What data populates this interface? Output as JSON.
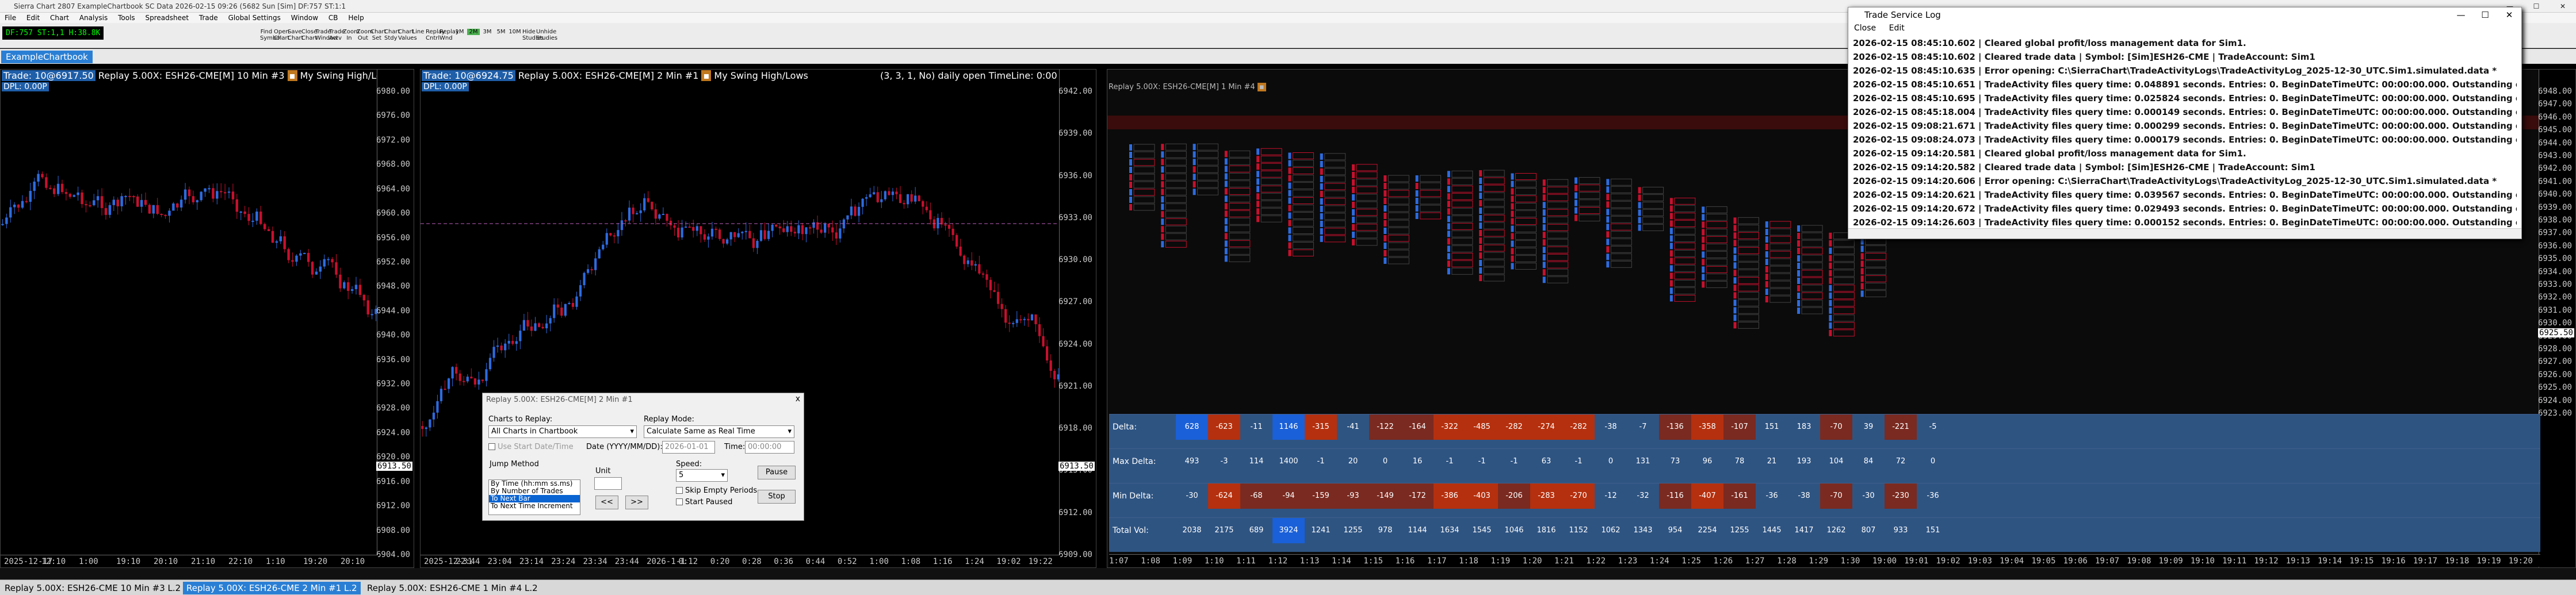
{
  "app": {
    "title": "Sierra Chart 2807 ExampleChartbook SC Data 2026-02-15 09:26 (5682 Sun [Sim] DF:757 ST:1:1",
    "window_buttons": [
      "—",
      "☐",
      "✕"
    ]
  },
  "menu": [
    "File",
    "Edit",
    "Chart",
    "Analysis",
    "Tools",
    "Spreadsheet",
    "Trade",
    "Global Settings",
    "Window",
    "CB",
    "Help"
  ],
  "toolbar": {
    "symbol_box": "DF:757  ST:1,1  H:38.8K",
    "buttons": [
      [
        "Find",
        "Symbol"
      ],
      [
        "Open",
        "Chart"
      ],
      [
        "Save",
        "Chart"
      ],
      [
        "Close",
        "Chart"
      ],
      [
        "Trade",
        "Window"
      ],
      [
        "Trade",
        "Actv"
      ],
      [
        "Zoom",
        "In"
      ],
      [
        "Zoom",
        "Out"
      ],
      [
        "Chart",
        "Set"
      ],
      [
        "Chart",
        "Stdy"
      ],
      [
        "Chart",
        "Values"
      ],
      [
        "Line"
      ],
      [
        "Replay",
        "Cntrl"
      ],
      [
        "Replay",
        "Wnd"
      ],
      [
        "1M"
      ],
      [
        "2M"
      ],
      [
        "3M"
      ],
      [
        "5M"
      ],
      [
        "10M"
      ],
      [
        "Hide",
        "Studies"
      ],
      [
        "Unhide",
        "Studies"
      ]
    ]
  },
  "chartbook_tab": "ExampleChartbook",
  "chart1": {
    "header_trade": "Trade: 10@6917.50",
    "header_rest": "Replay 5.00X: ESH26-CME[M]  10 Min  #3",
    "study": "My Swing High/Lows",
    "dpl": "DPL: 0.00P",
    "price_labels": [
      "6980.00",
      "6976.00",
      "6972.00",
      "6968.00",
      "6964.00",
      "6960.00",
      "6956.00",
      "6952.00",
      "6948.00",
      "6944.00",
      "6940.00",
      "6936.00",
      "6932.00",
      "6928.00",
      "6924.00",
      "6920.00",
      "6916.00",
      "6912.00",
      "6908.00",
      "6904.00"
    ],
    "last_price": "6913.50",
    "time_labels": [
      "2025-12-17",
      "12:10",
      "1:00",
      "19:10",
      "20:10",
      "21:10",
      "22:10",
      "1:10",
      "19:20",
      "20:10"
    ]
  },
  "chart2": {
    "header_trade": "Trade: 10@6924.75",
    "header_rest": "Replay 5.00X: ESH26-CME[M]  2 Min  #1",
    "study": "My Swing High/Lows",
    "extra": "(3, 3, 1, No)  daily open  TimeLine: 0:00",
    "dpl": "DPL: 0.00P",
    "price_labels": [
      "6942.00",
      "6939.00",
      "6936.00",
      "6933.00",
      "6930.00",
      "6927.00",
      "6924.00",
      "6921.00",
      "6918.00",
      "6915.00",
      "6912.00",
      "6909.00"
    ],
    "last_price": "6913.50",
    "time_labels": [
      "2025-12-31",
      "22:44",
      "23:04",
      "23:14",
      "23:24",
      "23:34",
      "23:44",
      "2026-1-1",
      "0:12",
      "0:20",
      "0:28",
      "0:36",
      "0:44",
      "0:52",
      "1:00",
      "1:08",
      "1:16",
      "1:24",
      "19:02",
      "19:22"
    ]
  },
  "chart3": {
    "header": "Replay 5.00X: ESH26-CME[M]  1 Min  #4",
    "price_labels": [
      "6948.00",
      "6947.00",
      "6946.00",
      "6945.00",
      "6944.00",
      "6943.00",
      "6942.00",
      "6941.00",
      "6940.00",
      "6939.00",
      "6938.00",
      "6937.00",
      "6936.00",
      "6935.00",
      "6934.00",
      "6933.00",
      "6932.00",
      "6931.00",
      "6930.00",
      "6929.00",
      "6928.00",
      "6927.00",
      "6926.00",
      "6925.00",
      "6924.00",
      "6923.00"
    ],
    "last_price": "6925.50",
    "row_labels": [
      "Delta:",
      "Max Delta:",
      "Min Delta:",
      "Total Vol:"
    ],
    "columns": [
      [
        "628",
        "493",
        "-30",
        "2038"
      ],
      [
        "-623",
        "-3",
        "-624",
        "2175"
      ],
      [
        "-11",
        "114",
        "-68",
        "689"
      ],
      [
        "1146",
        "1400",
        "-94",
        "3924"
      ],
      [
        "-315",
        "-1",
        "-159",
        "1241"
      ],
      [
        "-41",
        "20",
        "-93",
        "1255"
      ],
      [
        "-122",
        "0",
        "-149",
        "978"
      ],
      [
        "-164",
        "16",
        "-172",
        "1144"
      ],
      [
        "-322",
        "-1",
        "-386",
        "1634"
      ],
      [
        "-485",
        "-1",
        "-403",
        "1545"
      ],
      [
        "-282",
        "-1",
        "-206",
        "1046"
      ],
      [
        "-274",
        "63",
        "-283",
        "1816"
      ],
      [
        "-282",
        "-1",
        "-270",
        "1152"
      ],
      [
        "-38",
        "0",
        "-12",
        "1062"
      ],
      [
        "-7",
        "131",
        "-32",
        "1343"
      ],
      [
        "-136",
        "73",
        "-116",
        "954"
      ],
      [
        "-358",
        "96",
        "-407",
        "2254"
      ],
      [
        "-107",
        "78",
        "-161",
        "1255"
      ],
      [
        "151",
        "21",
        "-36",
        "1445"
      ],
      [
        "183",
        "193",
        "-38",
        "1417"
      ],
      [
        "-70",
        "104",
        "-70",
        "1262"
      ],
      [
        "39",
        "84",
        "-30",
        "807"
      ],
      [
        "-221",
        "72",
        "-230",
        "933"
      ],
      [
        "-5",
        "0",
        "-36",
        "151"
      ]
    ],
    "time_labels": [
      "1:07",
      "1:08",
      "1:09",
      "1:10",
      "1:11",
      "1:12",
      "1:13",
      "1:14",
      "1:15",
      "1:16",
      "1:17",
      "1:18",
      "1:19",
      "1:20",
      "1:21",
      "1:22",
      "1:23",
      "1:24",
      "1:25",
      "1:26",
      "1:27",
      "1:28",
      "1:29",
      "1:30",
      "19:00",
      "19:01",
      "19:02",
      "19:03",
      "19:04",
      "19:05",
      "19:06",
      "19:07",
      "19:08",
      "19:09",
      "19:10",
      "19:11",
      "19:12",
      "19:13",
      "19:14",
      "19:15",
      "19:16",
      "19:17",
      "19:18",
      "19:19",
      "19:20"
    ]
  },
  "replay_dialog": {
    "title": "Replay 5.00X: ESH26-CME[M]  2 Min  #1",
    "charts_label": "Charts to Replay:",
    "charts_value": "All Charts in Chartbook",
    "mode_label": "Replay Mode:",
    "mode_value": "Calculate Same as Real Time",
    "start_date_label": "Use Start Date/Time",
    "date_label": "Date (YYYY/MM/DD):",
    "date_value": "2026-01-01",
    "time_label": "Time:",
    "time_value": "00:00:00",
    "jump_label": "Jump Method",
    "jump_options": [
      "By Time (hh:mm ss.ms)",
      "By Number of Trades",
      "To Next Bar",
      "To Next Time Increment"
    ],
    "unit_label": "Unit",
    "speed_label": "Speed:",
    "speed_value": "5",
    "skip_label": "Skip Empty Periods",
    "start_paused_label": "Start Paused",
    "pause_label": "Pause",
    "stop_label": "Stop",
    "back_label": "<<",
    "fwd_label": ">>",
    "close_label": "x"
  },
  "trade_log": {
    "title": "Trade Service Log",
    "menu": [
      "Close",
      "Edit"
    ],
    "lines": [
      "2026-02-15  08:45:10.602 | Cleared global profit/loss management data for Sim1.",
      "2026-02-15  08:45:10.602 | Cleared trade data | Symbol: [Sim]ESH26-CME | TradeAccount: Sim1",
      "2026-02-15  08:45:10.635 | Error opening: C:\\SierraChart\\TradeActivityLogs\\TradeActivityLog_2025-12-30_UTC.Sim1.simulated.data *",
      "2026-02-15  08:45:10.651 | TradeActivity files query time: 0.048891 seconds. Entries: 0. BeginDateTimeUTC: 00:00:00.000. Outstanding queries: 0",
      "2026-02-15  08:45:10.695 | TradeActivity files query time: 0.025824 seconds. Entries: 0. BeginDateTimeUTC: 00:00:00.000. Outstanding queries: 0",
      "2026-02-15  08:45:18.004 | TradeActivity files query time: 0.000149 seconds. Entries: 0. BeginDateTimeUTC: 00:00:00.000. Outstanding queries: 0",
      "2026-02-15  09:08:21.671 | TradeActivity files query time: 0.000299 seconds. Entries: 0. BeginDateTimeUTC: 00:00:00.000. Outstanding queries: 0",
      "2026-02-15  09:08:24.073 | TradeActivity files query time: 0.000179 seconds. Entries: 0. BeginDateTimeUTC: 00:00:00.000. Outstanding queries: 0",
      "2026-02-15  09:14:20.581 | Cleared global profit/loss management data for Sim1.",
      "2026-02-15  09:14:20.582 | Cleared trade data | Symbol: [Sim]ESH26-CME | TradeAccount: Sim1",
      "2026-02-15  09:14:20.606 | Error opening: C:\\SierraChart\\TradeActivityLogs\\TradeActivityLog_2025-12-30_UTC.Sim1.simulated.data *",
      "2026-02-15  09:14:20.621 | TradeActivity files query time: 0.039567 seconds. Entries: 0. BeginDateTimeUTC: 00:00:00.000. Outstanding queries: 0",
      "2026-02-15  09:14:20.672 | TradeActivity files query time: 0.029493 seconds. Entries: 0. BeginDateTimeUTC: 00:00:00.000. Outstanding queries: 0",
      "2026-02-15  09:14:26.603 | TradeActivity files query time: 0.000152 seconds. Entries: 0. BeginDateTimeUTC: 00:00:00.000. Outstanding queries: 0"
    ]
  },
  "bottom_tabs": [
    "Replay 5.00X: ESH26-CME  10 Min  #3 L.2",
    "Replay 5.00X: ESH26-CME  2 Min  #1 L.2",
    "Replay 5.00X: ESH26-CME  1 Min  #4 L.2"
  ],
  "colors": {
    "up": "#2d6be0",
    "down": "#c8102e",
    "panel": "#2e5482",
    "accent": "#1f5ea8"
  }
}
